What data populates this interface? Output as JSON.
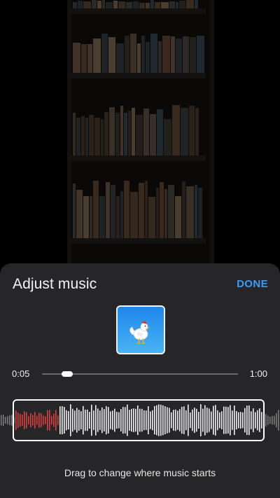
{
  "sheet": {
    "title": "Adjust music",
    "done_label": "DONE"
  },
  "album_art": {
    "icon": "rooster-icon",
    "background_color": "#2a90ee"
  },
  "playback": {
    "start_time": "0:05",
    "end_time": "1:00",
    "position_fraction": 0.13
  },
  "waveform": {
    "played_color": "#d9413f",
    "unplayed_color": "#f2f2f2",
    "outside_color": "#7a7a7a",
    "played_fraction": 0.19
  },
  "hint": "Drag to change where music starts"
}
